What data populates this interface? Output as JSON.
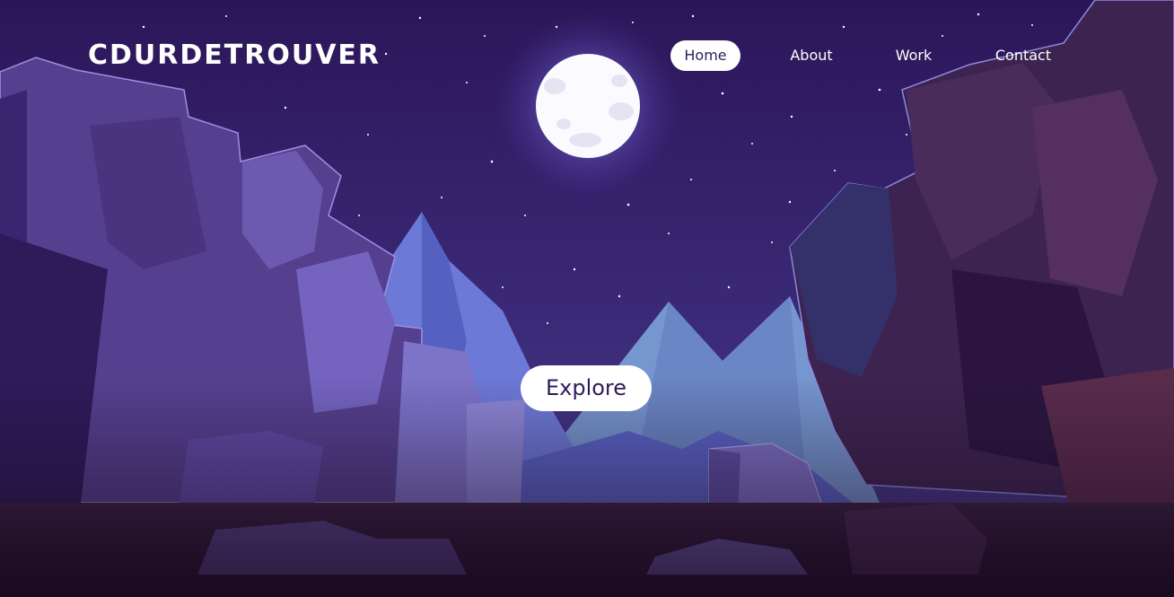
{
  "header": {
    "logo_text": "CDURDETROUVER"
  },
  "nav": {
    "items": [
      {
        "label": "Home",
        "active": true
      },
      {
        "label": "About",
        "active": false
      },
      {
        "label": "Work",
        "active": false
      },
      {
        "label": "Contact",
        "active": false
      }
    ]
  },
  "hero": {
    "cta_label": "Explore"
  },
  "colors": {
    "sky": "#2b1759",
    "accent_white": "#ffffff",
    "text_dark": "#2e1d5c",
    "moon_glow": "#8f7ff0"
  }
}
